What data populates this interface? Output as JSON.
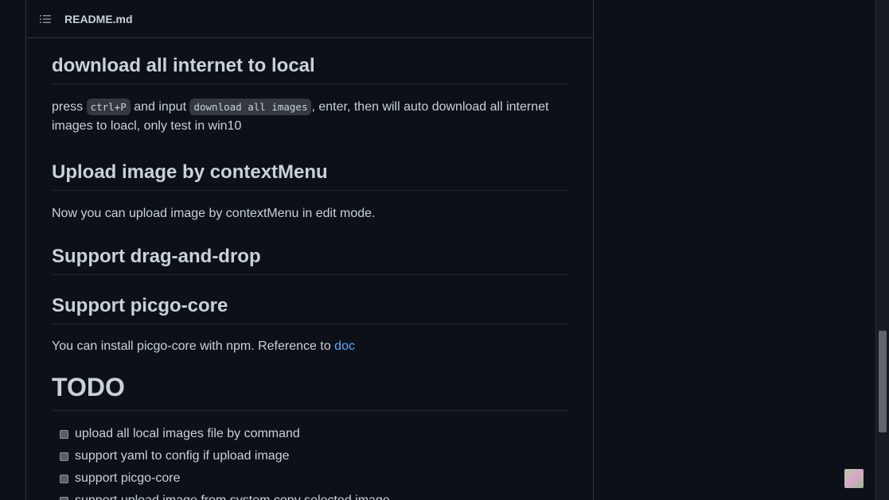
{
  "header": {
    "file_name": "README.md",
    "toc_icon": "list-unordered-icon"
  },
  "sections": {
    "download": {
      "title": "download all internet to local",
      "text_press": "press",
      "code_shortcut": "ctrl+P",
      "text_and_input": "and input",
      "code_command": "download all images",
      "text_rest_line1": ",  enter, then will auto download all internet",
      "text_rest_line2": "images to loacl, only test in win10"
    },
    "context_menu": {
      "title": "Upload image by contextMenu",
      "text": "Now you can upload image by contextMenu in edit mode."
    },
    "drag_drop": {
      "title": "Support drag-and-drop"
    },
    "picgo_core": {
      "title": "Support picgo-core",
      "text": "You can install picgo-core with npm. Reference to",
      "link": "doc"
    },
    "todo": {
      "title": "TODO",
      "items": [
        "upload all local images file by command",
        "support yaml to config if upload image",
        "support picgo-core",
        "support upload image from system copy selected image"
      ]
    }
  },
  "colors": {
    "background": "#0d1117",
    "text": "#c9d1d9",
    "link": "#58a6ff",
    "border": "#30363d"
  }
}
